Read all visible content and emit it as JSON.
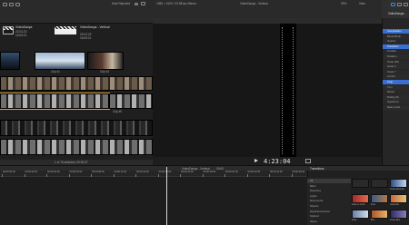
{
  "topbar": {
    "status_text": "Hide Rejected",
    "clip_info": "1080 × 1920 / 23.98 fps Stereo",
    "project_title": "VideoDanya - Vertical",
    "zoom": "39%",
    "view_label": "View",
    "inspector_title": "VideoDanya..."
  },
  "browser": {
    "events": [
      {
        "title": "VideoDanya",
        "sub1": "23.03.23",
        "sub2": "16:05:21"
      },
      {
        "title": "VideoDanya - Vertical",
        "sub1": "25.03.23",
        "sub2": "16:05:21"
      }
    ],
    "clip_labels": [
      "Clip 41",
      "Clip 43"
    ],
    "filmstrip_label": "Clip 45",
    "status": "1 of 76 selected, 00:00:07"
  },
  "viewer": {
    "timecode": "4:23:04"
  },
  "inspector": {
    "items": [
      "Composition",
      "Blend Mode",
      "Opacity",
      "Transform",
      "Position",
      "Rotation",
      "Scale (All)",
      "Scale X",
      "Scale Y",
      "Anchor",
      "Crop",
      "Trim",
      "Distort",
      "Rolling Sh",
      "Spatial Co",
      "Rate Confo"
    ]
  },
  "timeline": {
    "project": "VideoDanya - Vertical",
    "duration": "20:00",
    "ruler": [
      "00:00:00:00",
      "00:00:02:00",
      "00:00:04:00",
      "00:00:06:00",
      "00:00:08:00",
      "00:00:10:00",
      "00:00:12:00",
      "00:00:14:00",
      "00:00:16:00",
      "00:00:18:00",
      "00:00:20:00",
      "00:00:22:00",
      "00:00:24:00",
      "00:00:26:00"
    ]
  },
  "transitions": {
    "title": "Transitions",
    "categories": [
      "All",
      "Blurs",
      "Dissolves",
      "Lights",
      "Movements",
      "Objects",
      "Replicator/Clones",
      "Stylized",
      "Wipes"
    ],
    "thumbs": [
      "",
      "",
      "Cross Dissolve",
      "Fade to Color",
      "Flow",
      "Gaussian",
      "Fade",
      "Blur",
      "Cross Blur"
    ]
  },
  "colors": {
    "accent": "#e2a531",
    "selection": "#2f5fd0",
    "playhead": "#d9d9d9"
  }
}
